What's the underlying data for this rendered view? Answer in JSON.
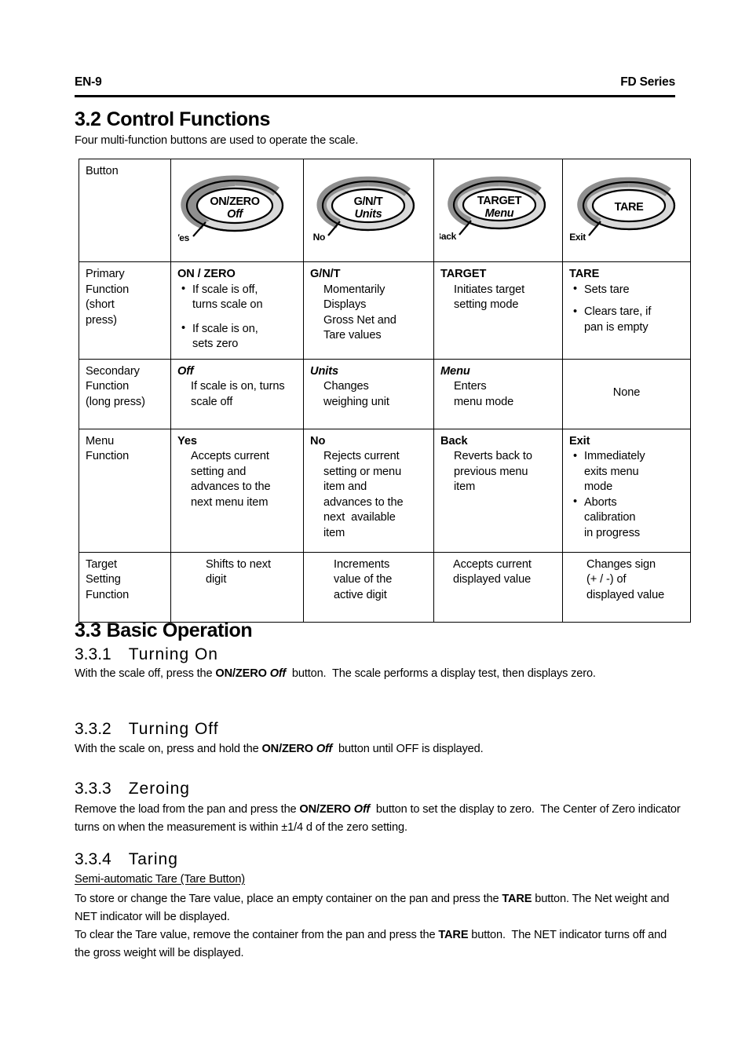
{
  "header": {
    "page_number": "EN-9",
    "manual_title": "FD Series"
  },
  "section_32": {
    "number": "3.2",
    "title": "Control Functions",
    "intro": "Four multi-function buttons are used to operate the scale."
  },
  "control_table": {
    "row_labels": {
      "header": "Button",
      "primary": "Primary\nFunction\n(short\npress)",
      "primary_lines": [
        "Primary",
        "Function",
        "(short",
        "press)"
      ],
      "secondary_lines": [
        "Secondary",
        "Function",
        "(long press)"
      ],
      "menu_lines": [
        "Menu",
        "Function"
      ],
      "target_lines": [
        "Target",
        "Setting",
        "Function"
      ]
    },
    "buttons": [
      {
        "name": "on-zero-button",
        "primary_label": "ON/ZERO",
        "secondary_label": "Off",
        "menu_tag": "Yes"
      },
      {
        "name": "gnt-button",
        "primary_label": "G/N/T",
        "secondary_label": "Units",
        "menu_tag": "No"
      },
      {
        "name": "target-button",
        "primary_label": "TARGET",
        "secondary_label": "Menu",
        "menu_tag": "Back"
      },
      {
        "name": "tare-button",
        "primary_label": "TARE",
        "secondary_label": "",
        "menu_tag": "Exit"
      }
    ],
    "primary_function": [
      {
        "title": "ON / ZERO",
        "bullets": [
          "If scale is off,\nturns scale on",
          "If scale is on,\nsets zero"
        ],
        "text": ""
      },
      {
        "title": "G/N/T",
        "bullets": [],
        "text": "Momentarily\nDisplays\nGross Net and\nTare values"
      },
      {
        "title": "TARGET",
        "bullets": [],
        "text": "Initiates target\nsetting mode"
      },
      {
        "title": "TARE",
        "bullets": [
          "Sets tare",
          "Clears tare, if\npan is empty"
        ],
        "text": ""
      }
    ],
    "secondary_function": [
      {
        "title": "Off",
        "title_italic": true,
        "text": "If scale is on, turns\nscale off",
        "center": false
      },
      {
        "title": "Units",
        "title_italic": true,
        "text": "Changes\nweighing unit",
        "center": false
      },
      {
        "title": "Menu",
        "title_italic": true,
        "text": "Enters\nmenu mode",
        "center": false
      },
      {
        "title": "",
        "title_italic": false,
        "text": "None",
        "center": true
      }
    ],
    "menu_function": [
      {
        "title": "Yes",
        "bullets": [],
        "text": "Accepts current\nsetting and\nadvances to the\nnext menu item"
      },
      {
        "title": "No",
        "bullets": [],
        "text": "Rejects current\nsetting or menu\nitem and\nadvances to the\nnext  available\nitem"
      },
      {
        "title": "Back",
        "bullets": [],
        "text": "Reverts back to\nprevious menu\nitem"
      },
      {
        "title": "Exit",
        "bullets": [
          "Immediately\nexits menu\nmode",
          "Aborts\ncalibration\nin progress"
        ],
        "text": ""
      }
    ],
    "target_setting_function": [
      "Shifts to next\ndigit",
      "Increments\nvalue of the\nactive digit",
      "Accepts current\ndisplayed value",
      "Changes sign\n(+ / -) of\ndisplayed value"
    ]
  },
  "section_33": {
    "number": "3.3",
    "title": "Basic Operation",
    "subsections": [
      {
        "number": "3.3.1",
        "title": "Turning  On",
        "paragraphs": [
          {
            "parts": [
              {
                "t": "With the scale off, press the ",
                "style": "normal"
              },
              {
                "t": "ON/ZERO ",
                "style": "bold"
              },
              {
                "t": "Off",
                "style": "bolditalic"
              },
              {
                "t": "  button.  The scale performs a display test, then displays zero.",
                "style": "normal"
              }
            ]
          }
        ]
      },
      {
        "number": "3.3.2",
        "title": "Turning  Off",
        "paragraphs": [
          {
            "parts": [
              {
                "t": "With the scale on, press and hold the ",
                "style": "normal"
              },
              {
                "t": "ON/ZERO ",
                "style": "bold"
              },
              {
                "t": "Off",
                "style": "bolditalic"
              },
              {
                "t": "  button until OFF is displayed.",
                "style": "normal"
              }
            ]
          }
        ]
      },
      {
        "number": "3.3.3",
        "title": "Zeroing",
        "paragraphs": [
          {
            "parts": [
              {
                "t": "Remove the load from the pan and press the ",
                "style": "normal"
              },
              {
                "t": "ON/ZERO ",
                "style": "bold"
              },
              {
                "t": "Off",
                "style": "bolditalic"
              },
              {
                "t": "  button to set the display to zero.  The Center of Zero indicator turns on when the measurement is within ±1/4 d of the zero setting.",
                "style": "normal"
              }
            ]
          }
        ]
      },
      {
        "number": "3.3.4",
        "title": "Taring",
        "sub_heading": "Semi-automatic Tare (Tare Button)",
        "paragraphs": [
          {
            "parts": [
              {
                "t": "To store or change the Tare value, place an empty container on the pan and press the ",
                "style": "normal"
              },
              {
                "t": "TARE",
                "style": "bold"
              },
              {
                "t": " button. The Net weight and NET indicator will be displayed.",
                "style": "normal"
              }
            ]
          },
          {
            "parts": [
              {
                "t": "To clear the Tare value, remove the container from the pan and press the ",
                "style": "normal"
              },
              {
                "t": "TARE",
                "style": "bold"
              },
              {
                "t": " button.  The NET indicator turns off and the gross weight will be displayed.",
                "style": "normal"
              }
            ]
          }
        ]
      }
    ]
  },
  "colors": {
    "ring_dark": "#8f8f8f",
    "ring_light": "#d9d9d9",
    "outline": "#000000",
    "page_background": "#ffffff"
  }
}
